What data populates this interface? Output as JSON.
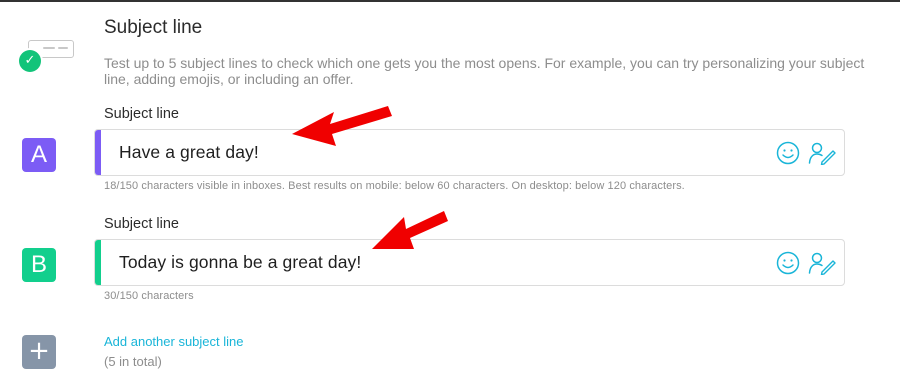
{
  "section": {
    "title": "Subject line",
    "description": "Test up to 5 subject lines to check which one gets you the most opens. For example, you can try personalizing your subject line, adding emojis, or including an offer."
  },
  "variants": [
    {
      "letter": "A",
      "label": "Subject line",
      "value": "Have a great day!",
      "help": "18/150 characters visible in inboxes. Best results on mobile: below 60 characters. On desktop: below 120 characters.",
      "color": "#7c5cf5"
    },
    {
      "letter": "B",
      "label": "Subject line",
      "value": "Today is gonna be a great day!",
      "help": "30/150 characters",
      "color": "#12cf8d"
    }
  ],
  "add": {
    "symbol": "+",
    "link_label": "Add another subject line",
    "note": "(5 in total)"
  },
  "icons": {
    "header": "subject-check-icon",
    "emoji": "smiley-icon",
    "personalize": "personalize-icon"
  },
  "colors": {
    "accent_link": "#19b5d8",
    "icon_stroke": "#19b5d8",
    "annotation": "#f00000",
    "add_badge": "#8695a8"
  }
}
